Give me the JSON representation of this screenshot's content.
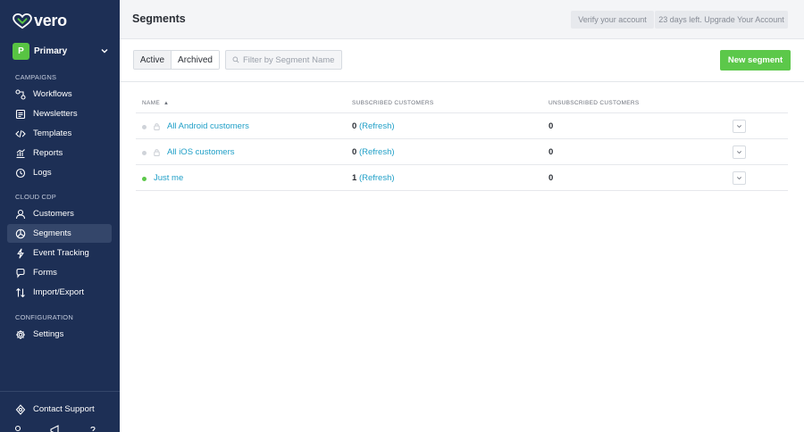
{
  "brand": {
    "name": "vero",
    "icon": "vero-heart-logo-icon",
    "accent_color": "#58c443",
    "sidebar_color": "#1d2f55",
    "link_color": "#1f9fc7"
  },
  "workspace": {
    "initial": "P",
    "name": "Primary"
  },
  "sidebar": {
    "sections": [
      {
        "label": "CAMPAIGNS",
        "items": [
          {
            "label": "Workflows",
            "icon": "workflow-icon"
          },
          {
            "label": "Newsletters",
            "icon": "newsletter-icon"
          },
          {
            "label": "Templates",
            "icon": "code-icon"
          },
          {
            "label": "Reports",
            "icon": "chart-icon"
          },
          {
            "label": "Logs",
            "icon": "clock-icon"
          }
        ]
      },
      {
        "label": "CLOUD CDP",
        "items": [
          {
            "label": "Customers",
            "icon": "user-icon"
          },
          {
            "label": "Segments",
            "icon": "pie-icon",
            "active": true
          },
          {
            "label": "Event Tracking",
            "icon": "lightning-icon"
          },
          {
            "label": "Forms",
            "icon": "form-icon"
          },
          {
            "label": "Import/Export",
            "icon": "import-export-icon"
          }
        ]
      },
      {
        "label": "CONFIGURATION",
        "items": [
          {
            "label": "Settings",
            "icon": "gear-icon"
          }
        ]
      }
    ],
    "support": {
      "label": "Contact Support",
      "icon": "support-icon"
    }
  },
  "header": {
    "title": "Segments",
    "verify_label": "Verify your account",
    "upgrade_label": "23 days left. Upgrade Your Account"
  },
  "toolbar": {
    "tabs": [
      {
        "label": "Active",
        "selected": true
      },
      {
        "label": "Archived"
      }
    ],
    "filter_placeholder": "Filter by Segment Name",
    "filter_value": "",
    "new_segment_label": "New segment"
  },
  "table": {
    "columns": [
      {
        "label": "NAME",
        "sort": "ascending"
      },
      {
        "label": "SUBSCRIBED CUSTOMERS"
      },
      {
        "label": "UNSUBSCRIBED CUSTOMERS"
      }
    ],
    "sort_indicator": "▲",
    "rows": [
      {
        "name": "All Android customers",
        "locked": true,
        "status": "inactive",
        "subscribed": "0",
        "refresh_label": "(Refresh)",
        "unsubscribed": "0"
      },
      {
        "name": "All iOS customers",
        "locked": true,
        "status": "inactive",
        "subscribed": "0",
        "refresh_label": "(Refresh)",
        "unsubscribed": "0"
      },
      {
        "name": "Just me",
        "locked": false,
        "status": "active",
        "subscribed": "1",
        "refresh_label": "(Refresh)",
        "unsubscribed": "0"
      }
    ]
  }
}
